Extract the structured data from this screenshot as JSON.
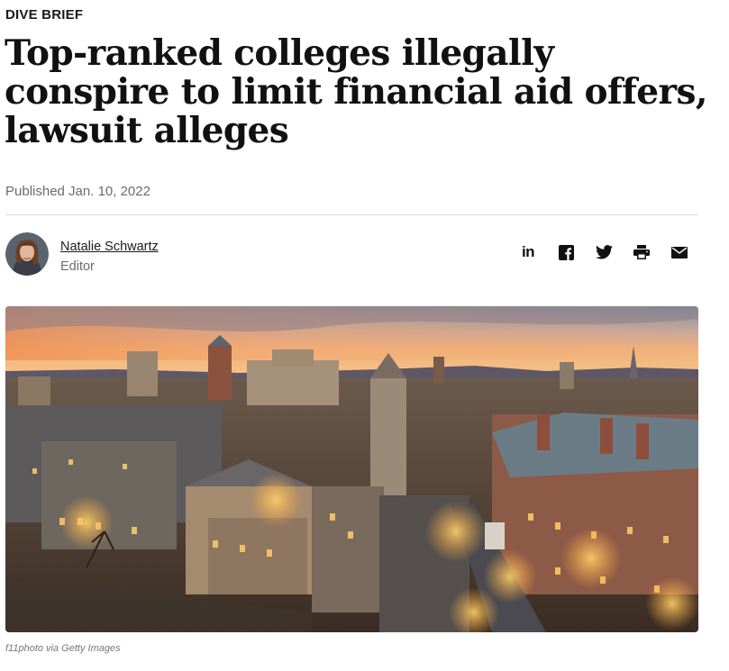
{
  "article": {
    "kicker": "DIVE BRIEF",
    "headline": "Top-ranked colleges illegally conspire to limit financial aid offers, lawsuit alleges",
    "published": "Published Jan. 10, 2022"
  },
  "author": {
    "name": "Natalie Schwartz",
    "role": "Editor"
  },
  "share": {
    "icons": [
      "linkedin-icon",
      "facebook-icon",
      "twitter-icon",
      "print-icon",
      "email-icon"
    ],
    "linkedin_text": "in"
  },
  "image": {
    "caption": "f11photo via Getty Images"
  }
}
